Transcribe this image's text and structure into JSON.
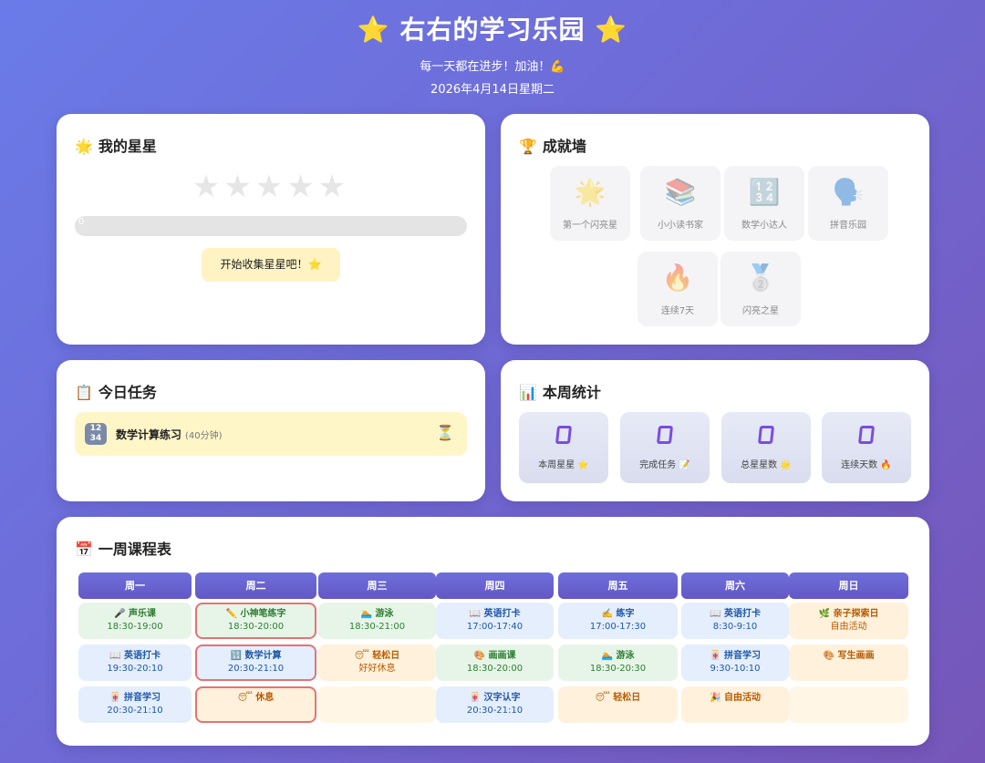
{
  "header": {
    "title": "⭐ 右右的学习乐园 ⭐",
    "subtitle": "每一天都在进步！加油！💪",
    "date": "2026年4月14日星期二"
  },
  "stars": {
    "title": "我的星星",
    "icon": "🌟",
    "star_glyphs": "★★★★★",
    "stars_filled": 0,
    "stars_total": 5,
    "progress_text": "0",
    "progress_fraction": 0,
    "button_label": "开始收集星星吧！⭐"
  },
  "achievements": {
    "title": "成就墙",
    "icon": "🏆",
    "items": [
      {
        "icon": "🌟",
        "label": "第一个闪亮星"
      },
      {
        "icon": "📚",
        "label": "小小读书家"
      },
      {
        "icon": "🔢",
        "label": "数学小达人"
      },
      {
        "icon": "🗣️",
        "label": "拼音乐园"
      },
      {
        "icon": "🔥",
        "label": "连续7天"
      },
      {
        "icon": "🥈",
        "label": "闪亮之星"
      }
    ]
  },
  "tasks": {
    "title": "今日任务",
    "icon": "📋",
    "items": [
      {
        "icon": "12 34",
        "name": "数学计算练习",
        "duration": "(40分钟)",
        "status_icon": "⏳"
      }
    ]
  },
  "stats": {
    "title": "本周统计",
    "icon": "📊",
    "items": [
      {
        "value": "",
        "label": "本周星星 ⭐"
      },
      {
        "value": "",
        "label": "完成任务 📝"
      },
      {
        "value": "",
        "label": "总星星数 🌟"
      },
      {
        "value": "",
        "label": "连续天数 🔥"
      }
    ]
  },
  "schedule": {
    "title": "一周课程表",
    "icon": "📅",
    "days": [
      "周一",
      "周二",
      "周三",
      "周四",
      "周五",
      "周六",
      "周日"
    ],
    "rows": [
      [
        {
          "name": "🎤 声乐课",
          "time": "18:30-19:00",
          "color": "green"
        },
        {
          "name": "✏️ 小神笔练字",
          "time": "18:30-20:00",
          "color": "green",
          "today": true
        },
        {
          "name": "🏊 游泳",
          "time": "18:30-21:00",
          "color": "green"
        },
        {
          "name": "📖 英语打卡",
          "time": "17:00-17:40",
          "color": "blue"
        },
        {
          "name": "✍️ 练字",
          "time": "17:00-17:30",
          "color": "blue"
        },
        {
          "name": "📖 英语打卡",
          "time": "8:30-9:10",
          "color": "blue"
        },
        {
          "name": "🌿 亲子探索日",
          "time": "自由活动",
          "color": "orange"
        }
      ],
      [
        {
          "name": "📖 英语打卡",
          "time": "19:30-20:10",
          "color": "blue"
        },
        {
          "name": "🔢 数学计算",
          "time": "20:30-21:10",
          "color": "blue",
          "today": true
        },
        {
          "name": "😴 轻松日",
          "time": "好好休息",
          "color": "orange"
        },
        {
          "name": "🎨 画画课",
          "time": "18:30-20:00",
          "color": "green"
        },
        {
          "name": "🏊 游泳",
          "time": "18:30-20:30",
          "color": "green"
        },
        {
          "name": "🀄 拼音学习",
          "time": "9:30-10:10",
          "color": "blue"
        },
        {
          "name": "🎨 写生画画",
          "time": "",
          "color": "orange"
        }
      ],
      [
        {
          "name": "🀄 拼音学习",
          "time": "20:30-21:10",
          "color": "blue"
        },
        {
          "name": "😴 休息",
          "time": "",
          "color": "orange",
          "today": true
        },
        {
          "name": "",
          "time": "",
          "color": "empty"
        },
        {
          "name": "🀄 汉字认字",
          "time": "20:30-21:10",
          "color": "blue"
        },
        {
          "name": "😴 轻松日",
          "time": "",
          "color": "orange"
        },
        {
          "name": "🎉 自由活动",
          "time": "",
          "color": "orange"
        },
        {
          "name": "",
          "time": "",
          "color": "empty"
        }
      ]
    ]
  }
}
